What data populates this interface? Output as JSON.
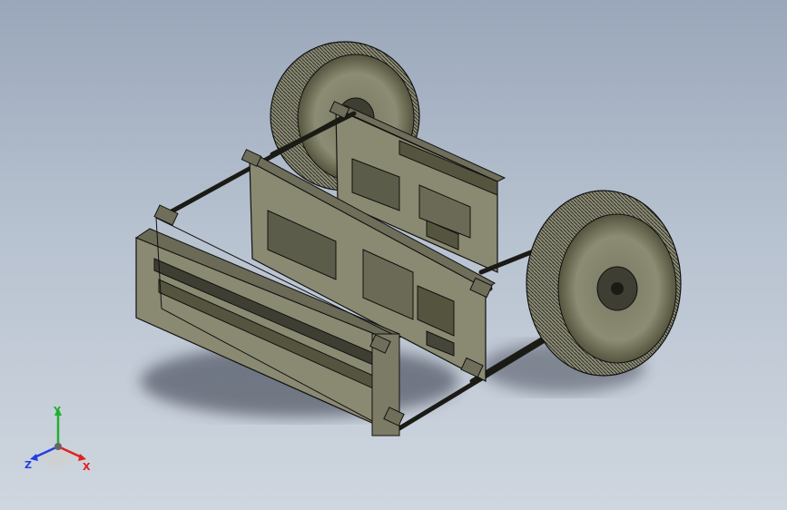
{
  "viewport": {
    "colors": {
      "background_top": "#9aa7ba",
      "background_bottom": "#cfd6df",
      "model_face": "#8a8a72",
      "model_dark": "#45453a",
      "edges": "#111111",
      "shadow": "#2e3340"
    }
  },
  "triad": {
    "x_label": "X",
    "y_label": "Y",
    "z_label": "Z",
    "x_color": "#e02020",
    "y_color": "#20b030",
    "z_color": "#2040e0"
  }
}
